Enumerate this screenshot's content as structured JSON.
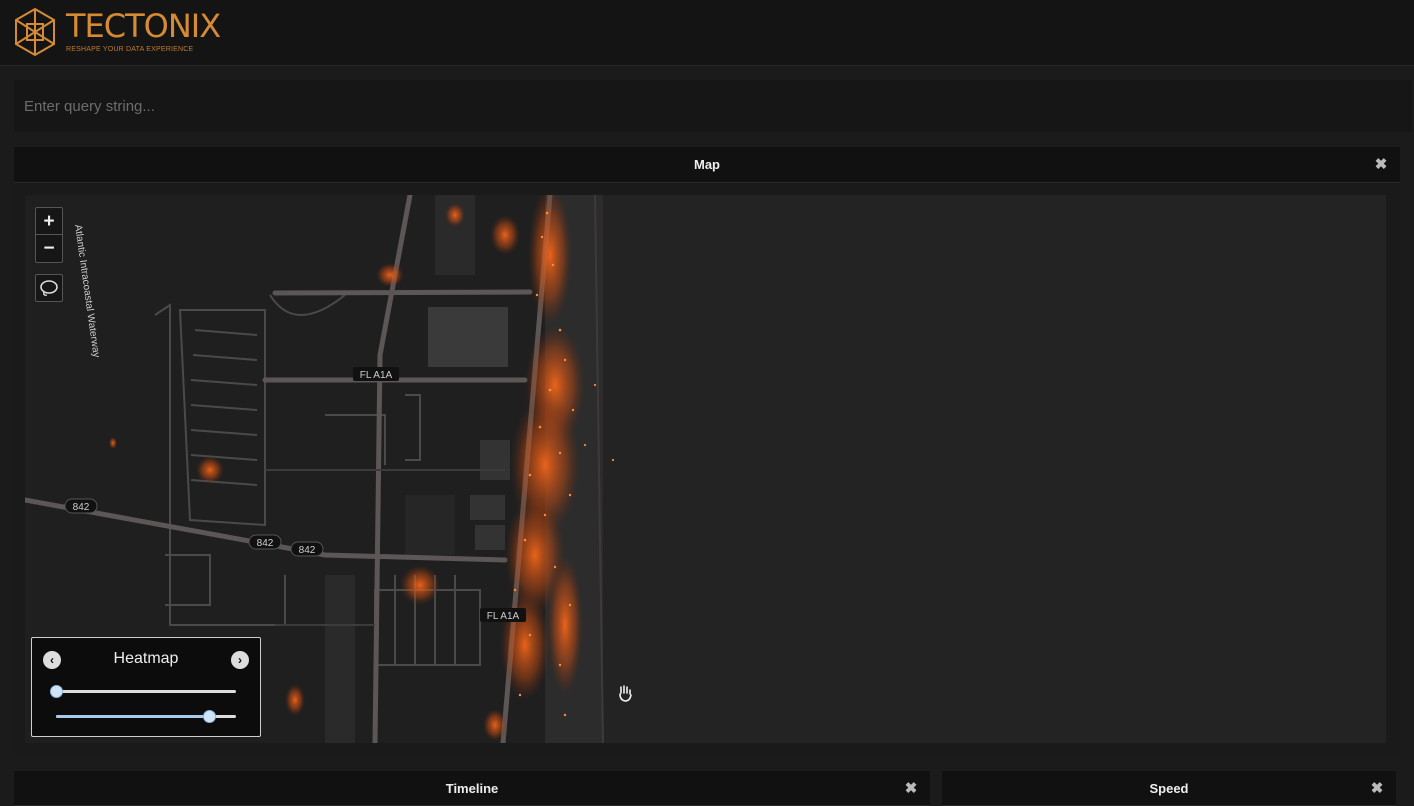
{
  "header": {
    "logo_name": "TECTONIX",
    "logo_tagline": "RESHAPE YOUR DATA EXPERIENCE",
    "brand_color": "#d68a34"
  },
  "query": {
    "placeholder": "Enter query string..."
  },
  "map_panel": {
    "title": "Map",
    "close_icon": "close-icon",
    "zoom_in_label": "+",
    "zoom_out_label": "−",
    "lasso_icon": "lasso-icon",
    "road_labels": {
      "fl_a1a_north": "FL A1A",
      "fl_a1a_south": "FL A1A",
      "route_842_west": "842",
      "route_842_mid": "842",
      "route_842_east": "842",
      "waterway": "Atlantic Intracoastal Waterway"
    },
    "heatmap_control": {
      "title": "Heatmap",
      "prev_icon": "chevron-left-icon",
      "next_icon": "chevron-right-icon",
      "slider_1_value": 0.0,
      "slider_2_value": 0.85,
      "heat_color": "#ff6a1a"
    }
  },
  "bottom_panels": {
    "timeline_title": "Timeline",
    "speed_title": "Speed"
  }
}
